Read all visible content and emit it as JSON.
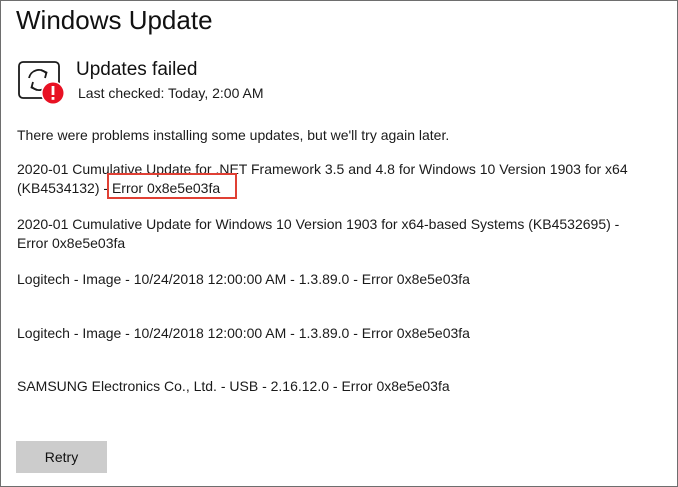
{
  "page": {
    "title": "Windows Update"
  },
  "status": {
    "title": "Updates failed",
    "last_checked": "Last checked: Today, 2:00 AM",
    "icon": "sync-error-icon",
    "error_badge_color": "#e81123"
  },
  "message": "There were problems installing some updates, but we'll try again later.",
  "updates": [
    {
      "line1": "2020-01 Cumulative Update for .NET Framework 3.5 and 4.8 for Windows 10 Version 1903 for x64",
      "line2_prefix": "(KB4534132) - ",
      "error": "Error 0x8e5e03fa"
    },
    {
      "line1": "2020-01 Cumulative Update for Windows 10 Version 1903 for x64-based Systems (KB4532695) -",
      "error": "Error 0x8e5e03fa"
    },
    {
      "text": "Logitech - Image - 10/24/2018 12:00:00 AM - 1.3.89.0 - Error 0x8e5e03fa"
    },
    {
      "text": "Logitech - Image - 10/24/2018 12:00:00 AM - 1.3.89.0 - Error 0x8e5e03fa"
    },
    {
      "text": "SAMSUNG Electronics Co., Ltd.  - USB - 2.16.12.0 - Error 0x8e5e03fa"
    }
  ],
  "annotation": {
    "highlight_color": "#e04034"
  },
  "buttons": {
    "retry_label": "Retry"
  }
}
